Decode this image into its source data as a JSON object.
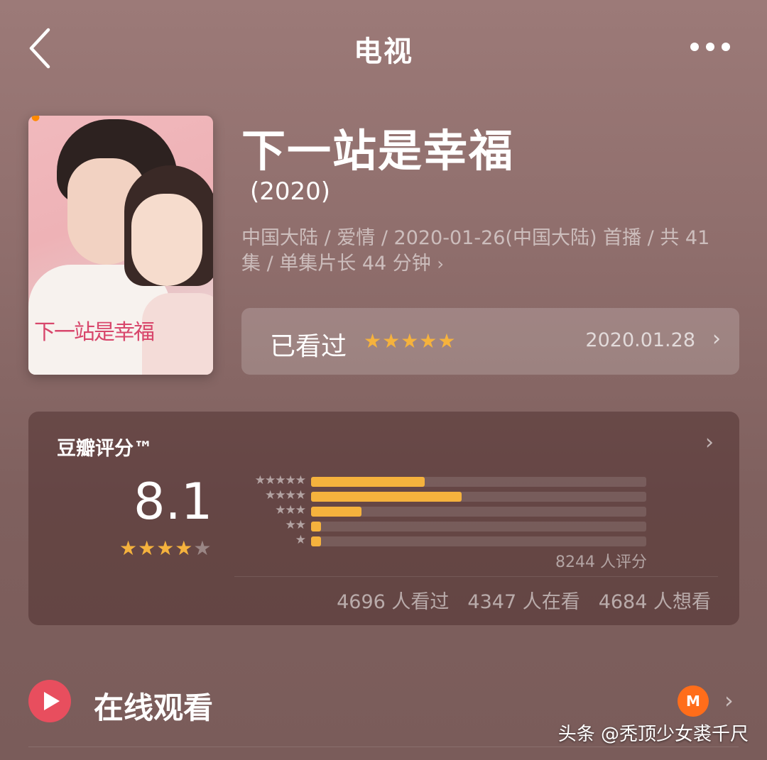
{
  "nav": {
    "title": "电视",
    "back_icon": "chevron-left-icon",
    "more_icon": "more-dots-icon"
  },
  "show": {
    "title": "下一站是幸福",
    "year": "(2020)",
    "meta_line1": "中国大陆 / 爱情 / 2020-01-26(中国大陆) 首播 / 共 41",
    "meta_line2": "集 / 单集片长 44 分钟",
    "poster_title": "下一站是幸福"
  },
  "watched": {
    "label": "已看过",
    "stars": "★★★★★",
    "date": "2020.01.28"
  },
  "rating": {
    "heading": "豆瓣评分™",
    "score": "8.1",
    "stars_on": "★★★★",
    "stars_off": "★",
    "distribution": [
      {
        "stars": "★★★★★",
        "fraction": 0.34
      },
      {
        "stars": "★★★★",
        "fraction": 0.45
      },
      {
        "stars": "★★★",
        "fraction": 0.15
      },
      {
        "stars": "★★",
        "fraction": 0.03
      },
      {
        "stars": "★",
        "fraction": 0.03
      }
    ],
    "count": "8244 人评分",
    "watched": "4696 人看过",
    "watching": "4347 人在看",
    "want": "4684 人想看"
  },
  "online": {
    "label": "在线观看",
    "provider_icon": "M"
  },
  "watermark": "头条 @秃顶少女裘千尺",
  "colors": {
    "accent": "#f5b23d",
    "play": "#e84e5e",
    "provider": "#ff6d1a"
  }
}
